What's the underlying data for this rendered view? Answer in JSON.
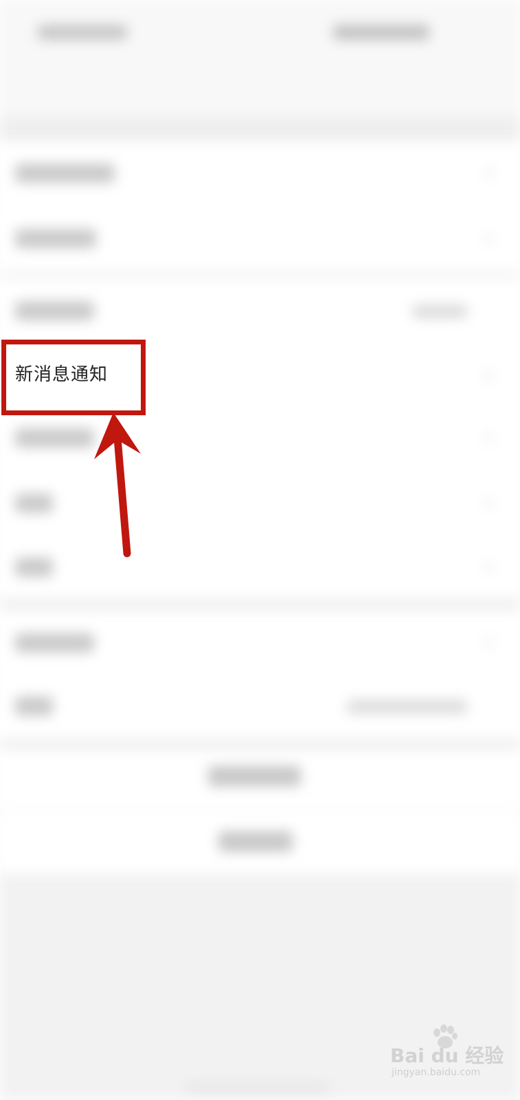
{
  "highlight": {
    "label": "新消息通知",
    "border_color": "#c0170f"
  },
  "arrow": {
    "color": "#c0170f",
    "direction": "up",
    "target": "新消息通知"
  },
  "watermark": {
    "brand_text": "Bai du 经验",
    "url_text": "jingyan.baidu.com"
  }
}
